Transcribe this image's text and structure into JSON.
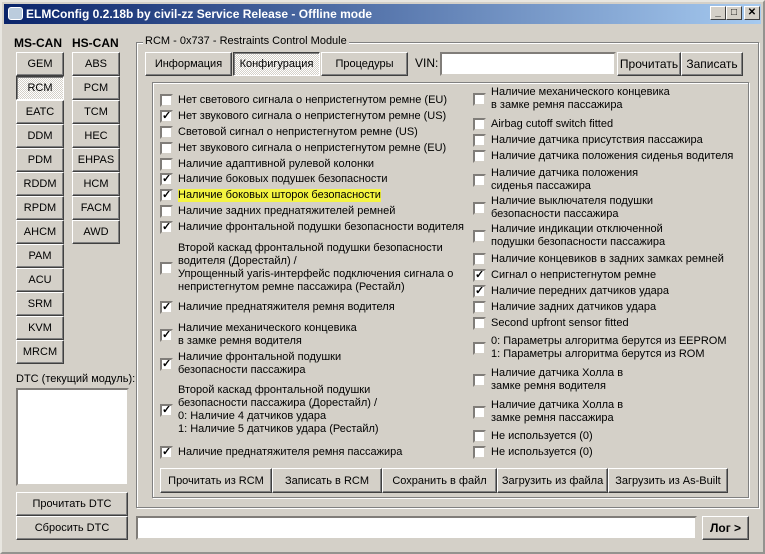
{
  "window": {
    "title": "ELMConfig 0.2.18b by civil-zz Service Release - Offline mode",
    "minimize": "_",
    "maximize": "□",
    "close": "✕"
  },
  "left": {
    "ms_can_label": "MS-CAN",
    "hs_can_label": "HS-CAN",
    "ms_can": [
      "GEM",
      "RCM",
      "EATC",
      "DDM",
      "PDM",
      "RDDM",
      "RPDM",
      "AHCM",
      "PAM",
      "ACU",
      "SRM",
      "KVM",
      "MRCM"
    ],
    "hs_can": [
      "ABS",
      "PCM",
      "TCM",
      "HEC",
      "EHPAS",
      "HCM",
      "FACM",
      "AWD"
    ],
    "selected": "RCM",
    "dtc_label": "DTC (текущий модуль):",
    "read_dtc": "Прочитать DTC",
    "clear_dtc": "Сбросить DTC"
  },
  "module": {
    "group_title": "RCM - 0x737 - Restraints Control Module",
    "tabs": [
      "Информация",
      "Конфигурация",
      "Процедуры"
    ],
    "active_tab": "Конфигурация",
    "vin_label": "VIN:",
    "vin_value": "",
    "read_button": "Прочитать",
    "write_button": "Записать",
    "left_options": [
      {
        "label": "Нет светового сигнала о непристегнутом ремне (EU)",
        "checked": false
      },
      {
        "label": "Нет звукового сигнала о непристегнутом ремне (US)",
        "checked": true
      },
      {
        "label": "Световой сигнал о непристегнутом ремне (US)",
        "checked": false
      },
      {
        "label": "Нет звукового сигнала о непристегнутом ремне (EU)",
        "checked": false
      },
      {
        "label": "Наличие адаптивной рулевой колонки",
        "checked": false
      },
      {
        "label": "Наличие боковых подушек безопасности",
        "checked": true
      },
      {
        "label": "Наличие боковых шторок безопасности",
        "checked": true,
        "highlighted": true
      },
      {
        "label": "Наличие задних преднатяжителей ремней",
        "checked": false
      },
      {
        "label": "Наличие фронтальной подушки безопасности водителя",
        "checked": true
      },
      {
        "label": "Второй каскад фронтальной подушки безопасности\nводителя (Дорестайл) /\nУпрощенный yaris-интерфейс подключения сигнала о\nнепристегнутом ремне пассажира (Рестайл)",
        "checked": false
      },
      {
        "label": "Наличие преднатяжителя ремня водителя",
        "checked": true
      },
      {
        "label": "Наличие механического концевика\nв замке ремня водителя",
        "checked": true
      },
      {
        "label": "Наличие фронтальной подушки\nбезопасности пассажира",
        "checked": true
      },
      {
        "label": "Второй каскад фронтальной подушки\nбезопасности пассажира (Дорестайл) /\n0: Наличие 4 датчиков удара\n1: Наличие 5 датчиков удара (Рестайл)",
        "checked": true
      },
      {
        "label": "Наличие преднатяжителя ремня пассажира",
        "checked": true
      }
    ],
    "right_options": [
      {
        "label": "Наличие механического концевика\nв замке ремня пассажира",
        "checked": false
      },
      {
        "label": "Airbag cutoff switch fitted",
        "checked": false
      },
      {
        "label": "Наличие датчика присутствия пассажира",
        "checked": false
      },
      {
        "label": "Наличие датчика положения сиденья водителя",
        "checked": false
      },
      {
        "label": "Наличие датчика положения\nсиденья пассажира",
        "checked": false
      },
      {
        "label": "Наличие выключателя подушки\nбезопасности пассажира",
        "checked": false
      },
      {
        "label": "Наличие индикации отключенной\nподушки безопасности пассажира",
        "checked": false
      },
      {
        "label": "Наличие концевиков в задних замках ремней",
        "checked": false
      },
      {
        "label": "Сигнал о непристегнутом ремне",
        "checked": true
      },
      {
        "label": "Наличие передних датчиков удара",
        "checked": true
      },
      {
        "label": "Наличие задних датчиков удара",
        "checked": false
      },
      {
        "label": "Second upfront sensor fitted",
        "checked": false
      },
      {
        "label": "0: Параметры алгоритма берутся из EEPROM\n1: Параметры алгоритма берутся из ROM",
        "checked": false
      },
      {
        "label": "Наличие датчика Холла в\nзамке ремня водителя",
        "checked": false
      },
      {
        "label": "Наличие датчика Холла в\nзамке ремня пассажира",
        "checked": false
      },
      {
        "label": "Не используется (0)",
        "checked": false
      },
      {
        "label": "Не используется (0)",
        "checked": false
      }
    ],
    "actions": [
      "Прочитать из RCM",
      "Записать в RCM",
      "Сохранить в файл",
      "Загрузить из файла",
      "Загрузить из As-Built"
    ]
  },
  "footer": {
    "log_value": "",
    "log_button": "Лог >"
  },
  "colors": {
    "highlight": "#f4f442",
    "titlebar": "#0a246a"
  }
}
